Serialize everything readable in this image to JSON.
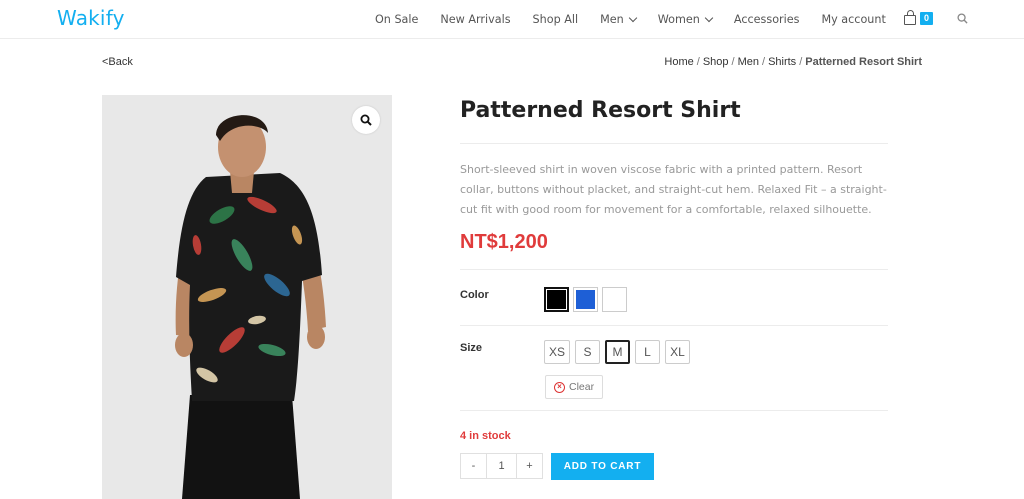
{
  "header": {
    "logo": "Wakify",
    "nav": [
      {
        "label": "On Sale",
        "dropdown": false
      },
      {
        "label": "New Arrivals",
        "dropdown": false
      },
      {
        "label": "Shop All",
        "dropdown": false
      },
      {
        "label": "Men",
        "dropdown": true
      },
      {
        "label": "Women",
        "dropdown": true
      },
      {
        "label": "Accessories",
        "dropdown": false
      },
      {
        "label": "My account",
        "dropdown": false
      }
    ],
    "cart_count": "0"
  },
  "page": {
    "back_label": "<Back",
    "breadcrumb": [
      "Home",
      "Shop",
      "Men",
      "Shirts"
    ],
    "breadcrumb_current": "Patterned Resort Shirt"
  },
  "product": {
    "title": "Patterned Resort Shirt",
    "description": "Short-sleeved shirt in woven viscose fabric with a printed pattern. Resort collar, buttons without placket, and straight-cut hem. Relaxed Fit – a straight-cut fit with good room for movement for a comfortable, relaxed silhouette.",
    "price": "NT$1,200",
    "color_label": "Color",
    "colors": [
      {
        "name": "black",
        "hex": "#000000",
        "selected": true
      },
      {
        "name": "blue",
        "hex": "#1e5fd6",
        "selected": false
      },
      {
        "name": "white",
        "hex": "#ffffff",
        "selected": false
      }
    ],
    "size_label": "Size",
    "sizes": [
      {
        "label": "XS",
        "selected": false
      },
      {
        "label": "S",
        "selected": false
      },
      {
        "label": "M",
        "selected": true
      },
      {
        "label": "L",
        "selected": false
      },
      {
        "label": "XL",
        "selected": false
      }
    ],
    "clear_label": "Clear",
    "stock": "4 in stock",
    "qty_minus": "-",
    "quantity": "1",
    "qty_plus": "+",
    "add_to_cart": "ADD TO CART"
  },
  "colors": {
    "accent": "#13aff0",
    "price": "#e03b3b"
  }
}
